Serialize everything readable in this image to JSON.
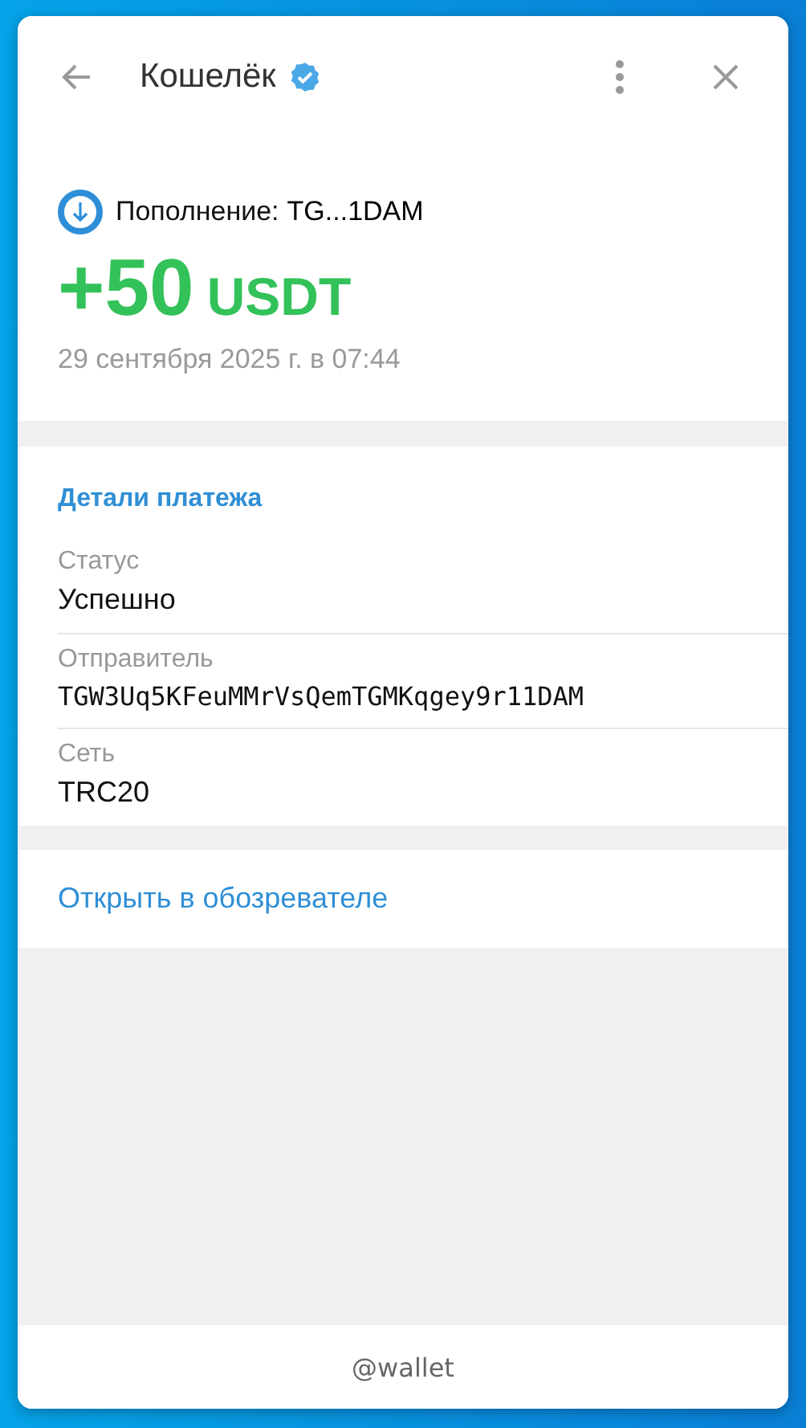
{
  "window": {
    "title": "Кошелёк",
    "verified": true
  },
  "transaction": {
    "label": "Пополнение:",
    "address": "TG...1DAM",
    "amount": "+50",
    "currency": "USDT",
    "date": "29 сентября 2025 г. в 07:44"
  },
  "details": {
    "heading": "Детали платежа",
    "rows": [
      {
        "label": "Статус",
        "value": "Успешно",
        "kind": "text"
      },
      {
        "label": "Отправитель",
        "value": "TGW3Uq5KFeuMMrVsQemTGMKqgey9r11DAM",
        "kind": "address"
      },
      {
        "label": "Сеть",
        "value": "TRC20",
        "kind": "text"
      }
    ]
  },
  "link": "Открыть в обозревателе",
  "footer": "@wallet"
}
